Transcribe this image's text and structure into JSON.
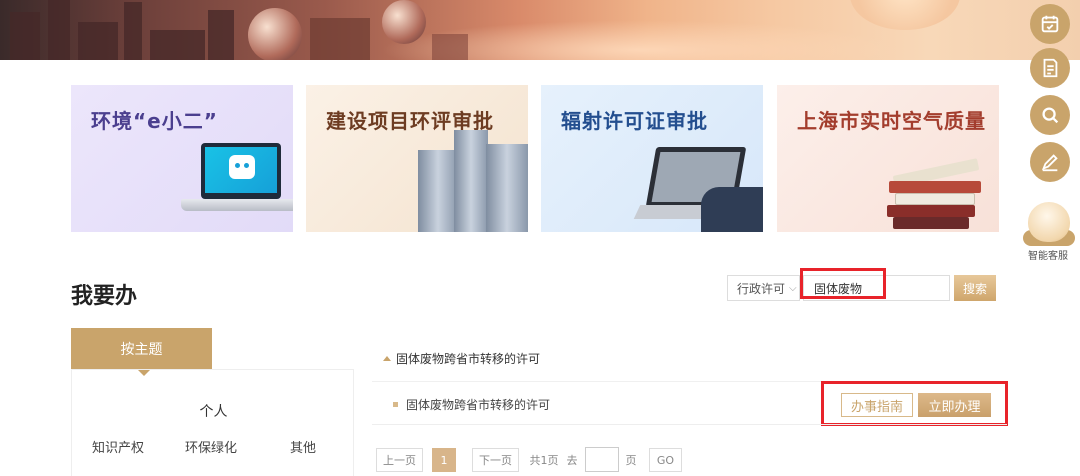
{
  "tiles": [
    {
      "title": "环境“e小二”"
    },
    {
      "title": "建设项目环评审批"
    },
    {
      "title": "辐射许可证审批"
    },
    {
      "title": "上海市实时空气质量"
    }
  ],
  "sidebar": {
    "bot_label": "智能客服",
    "icons": [
      "calendar-check-icon",
      "document-edit-icon",
      "search-icon",
      "pen-icon"
    ]
  },
  "section": {
    "title": "我要办"
  },
  "search": {
    "category": "行政许可",
    "query": "固体废物",
    "button": "搜索"
  },
  "themes": {
    "tab_label": "按主题",
    "group_label": "个人",
    "categories": [
      "知识产权",
      "环保绿化",
      "其他"
    ]
  },
  "results": {
    "group_title": "固体废物跨省市转移的许可",
    "items": [
      {
        "name": "固体废物跨省市转移的许可",
        "guide": "办事指南",
        "apply": "立即办理"
      }
    ]
  },
  "pagination": {
    "prev": "上一页",
    "current": "1",
    "next": "下一页",
    "total": "共1页",
    "goto_prefix": "去",
    "goto_suffix": "页",
    "go": "GO"
  },
  "colors": {
    "accent": "#c9a46b",
    "highlight": "#e8232a"
  }
}
